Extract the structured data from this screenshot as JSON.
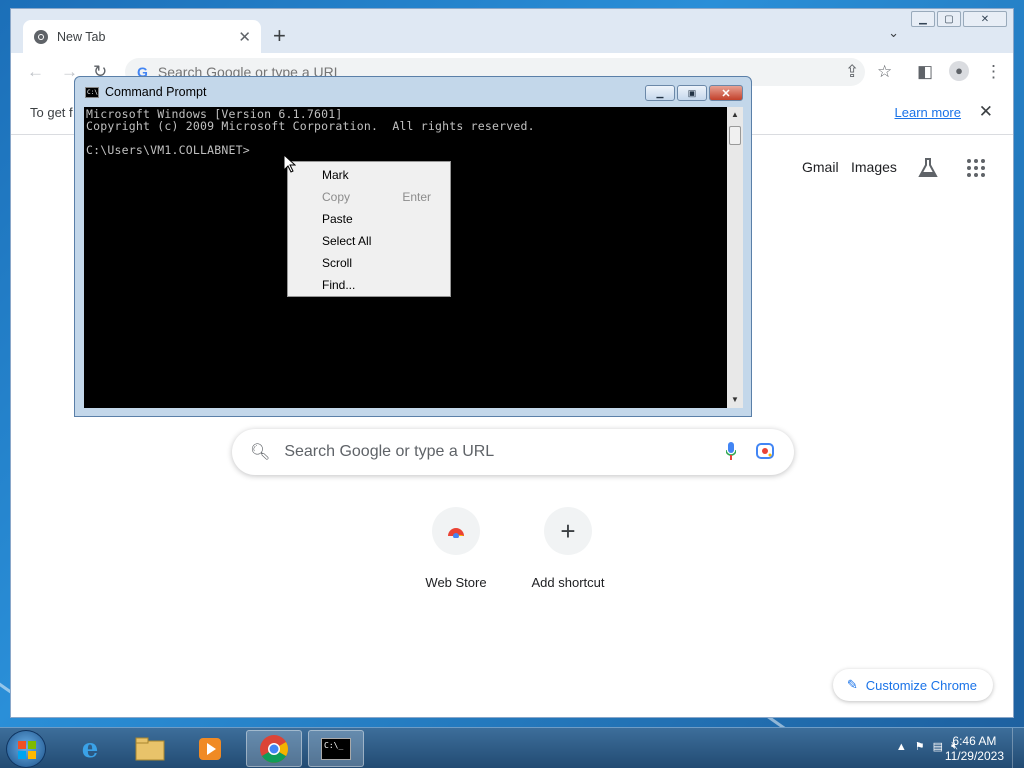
{
  "browser": {
    "tab_title": "New Tab",
    "omnibox_placeholder": "Search Google or type a URL",
    "infobar_text": "To get f",
    "infobar_link": "Learn more",
    "gmail": "Gmail",
    "images": "Images",
    "search_placeholder": "Search Google or type a URL",
    "shortcuts": [
      {
        "label": "Web Store"
      },
      {
        "label": "Add shortcut",
        "glyph": "+"
      }
    ],
    "customize": "Customize Chrome",
    "accent_color": "#1a73e8"
  },
  "cmd": {
    "title": "Command Prompt",
    "console_text": "Microsoft Windows [Version 6.1.7601]\nCopyright (c) 2009 Microsoft Corporation.  All rights reserved.\n\nC:\\Users\\VM1.COLLABNET>",
    "context_menu": [
      {
        "label": "Mark",
        "shortcut": "",
        "disabled": false
      },
      {
        "label": "Copy",
        "shortcut": "Enter",
        "disabled": true
      },
      {
        "label": "Paste",
        "shortcut": "",
        "disabled": false
      },
      {
        "label": "Select All",
        "shortcut": "",
        "disabled": false
      },
      {
        "label": "Scroll",
        "shortcut": "",
        "disabled": false
      },
      {
        "label": "Find...",
        "shortcut": "",
        "disabled": false
      }
    ]
  },
  "taskbar": {
    "time": "6:46 AM",
    "date": "11/29/2023"
  }
}
